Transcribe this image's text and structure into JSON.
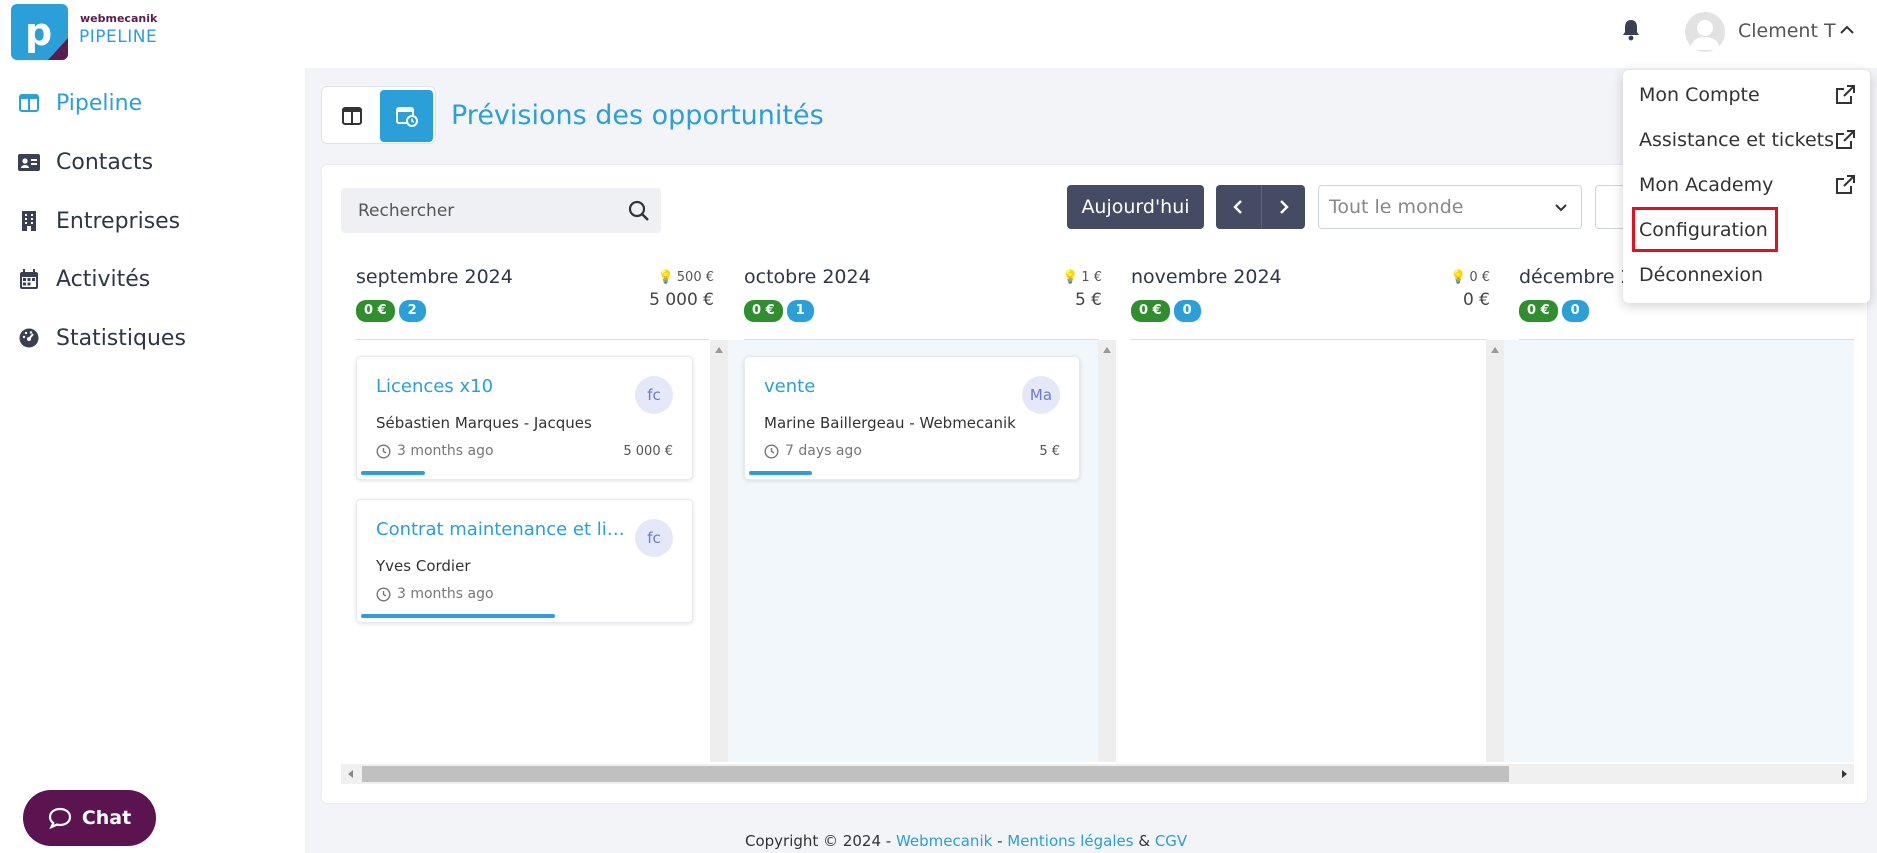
{
  "brand": {
    "small": "webmecanik",
    "big": "PIPELINE",
    "logo_letter": "p"
  },
  "header": {
    "user_name": "Clement T"
  },
  "sidebar": {
    "items": [
      {
        "label": "Pipeline",
        "icon": "columns-icon"
      },
      {
        "label": "Contacts",
        "icon": "id-card-icon"
      },
      {
        "label": "Entreprises",
        "icon": "building-icon"
      },
      {
        "label": "Activités",
        "icon": "calendar-icon"
      },
      {
        "label": "Statistiques",
        "icon": "dashboard-icon"
      }
    ]
  },
  "chat": {
    "label": "Chat"
  },
  "page": {
    "title": "Prévisions des opportunités"
  },
  "toolbar": {
    "search_placeholder": "Rechercher",
    "today_label": "Aujourd'hui",
    "owner_filter": "Tout le monde"
  },
  "columns": [
    {
      "month": "septembre 2024",
      "hint": "500 €",
      "total": "5 000 €",
      "badge_amount": "0 €",
      "badge_count": "2"
    },
    {
      "month": "octobre 2024",
      "hint": "1 €",
      "total": "5 €",
      "badge_amount": "0 €",
      "badge_count": "1"
    },
    {
      "month": "novembre 2024",
      "hint": "0 €",
      "total": "0 €",
      "badge_amount": "0 €",
      "badge_count": "0"
    },
    {
      "month": "décembre 2",
      "hint": "",
      "total": "",
      "badge_amount": "0 €",
      "badge_count": "0"
    }
  ],
  "cards": [
    {
      "title": "Licences x10",
      "contact": "Sébastien Marques - Jacques",
      "time": "3 months ago",
      "amount": "5 000 €",
      "avatar": "fc",
      "progress": 0.19
    },
    {
      "title": "Contrat maintenance et licences",
      "contact": "Yves Cordier",
      "time": "3 months ago",
      "amount": "",
      "avatar": "fc",
      "progress": 0.58
    },
    {
      "title": "vente",
      "contact": "Marine Baillergeau - Webmecanik",
      "time": "7 days ago",
      "amount": "5 €",
      "avatar": "Ma",
      "progress": 0.19
    }
  ],
  "footer": {
    "copyright": "Copyright © 2024 - ",
    "webmecanik": "Webmecanik",
    "sep1": " - ",
    "mentions": "Mentions légales",
    "amp": " & ",
    "cgv": "CGV"
  },
  "user_menu": {
    "items": [
      {
        "label": "Mon Compte",
        "external": true
      },
      {
        "label": "Assistance et tickets",
        "external": true
      },
      {
        "label": "Mon Academy",
        "external": true
      },
      {
        "label": "Configuration",
        "external": false
      },
      {
        "label": "Déconnexion",
        "external": false
      }
    ]
  },
  "colors": {
    "accent": "#2a9fd8",
    "dark": "#454b63",
    "brand_purple": "#5b1450",
    "green": "#2f8f2e",
    "highlight": "#e3101f"
  }
}
